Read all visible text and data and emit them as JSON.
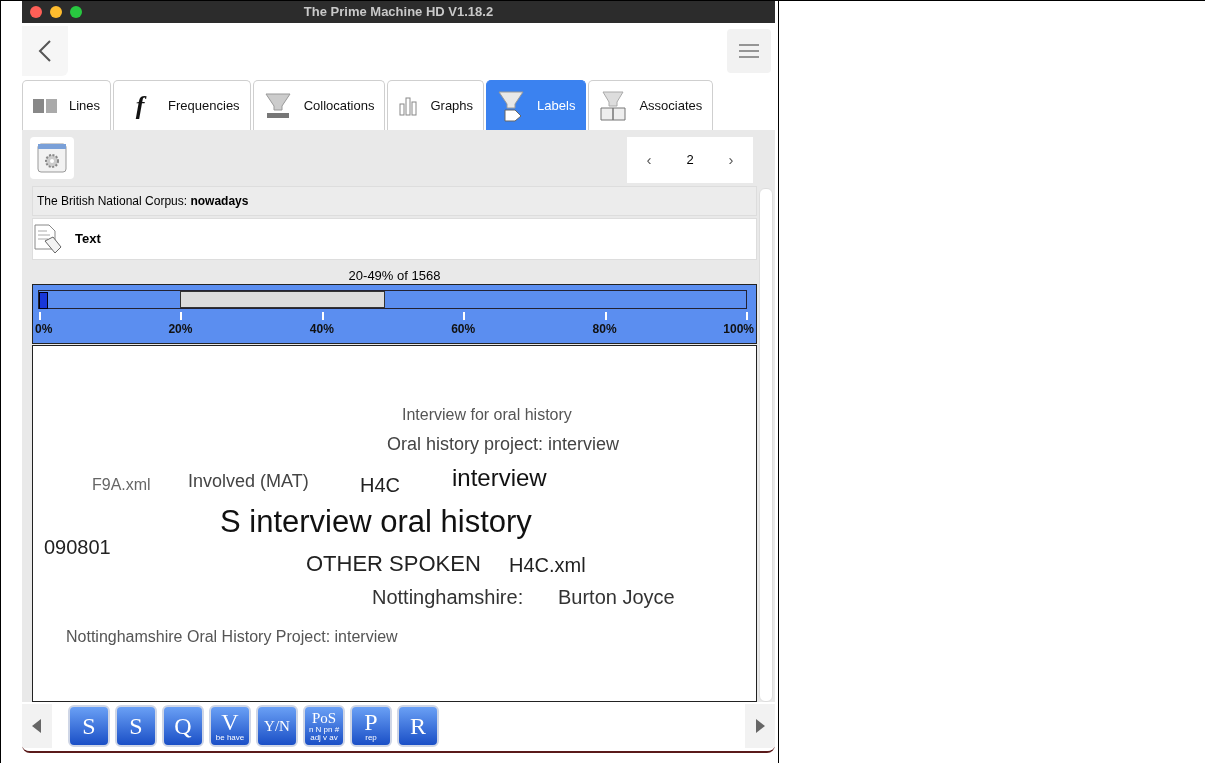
{
  "window": {
    "title": "The Prime Machine HD V1.18.2"
  },
  "tabs": [
    {
      "label": "Lines",
      "kind": "lines",
      "selected": false
    },
    {
      "label": "Frequencies",
      "kind": "glyph",
      "glyph": "f",
      "selected": false
    },
    {
      "label": "Collocations",
      "kind": "funnel",
      "selected": false
    },
    {
      "label": "Graphs",
      "kind": "graphs",
      "selected": false
    },
    {
      "label": "Labels",
      "kind": "labels",
      "selected": true
    },
    {
      "label": "Associates",
      "kind": "book",
      "selected": false
    }
  ],
  "pager": {
    "prev": "‹",
    "page": "2",
    "next": "›"
  },
  "corpus_line": "The British National Corpus: **nowadays**",
  "section": {
    "title": "Text"
  },
  "range": {
    "caption": "20-49% of 1568",
    "ticks": [
      "0%",
      "20%",
      "40%",
      "60%",
      "80%",
      "100%"
    ]
  },
  "cloud": [
    {
      "text": "Interview for oral history"
    },
    {
      "text": "Oral history project: interview"
    },
    {
      "text": "F9A.xml"
    },
    {
      "text": "Involved (MAT)"
    },
    {
      "text": "H4C"
    },
    {
      "text": "interview"
    },
    {
      "text": "S interview oral history"
    },
    {
      "text": "090801"
    },
    {
      "text": "OTHER SPOKEN"
    },
    {
      "text": "H4C.xml"
    },
    {
      "text": "Nottinghamshire:"
    },
    {
      "text": "Burton Joyce"
    },
    {
      "text": "Nottinghamshire Oral History Project: interview"
    }
  ],
  "tools": [
    {
      "letter": "S"
    },
    {
      "letter": "S"
    },
    {
      "letter": "Q"
    },
    {
      "letter": "V",
      "sub": "be have"
    },
    {
      "letter": "Y/N"
    },
    {
      "letter": "PoS",
      "sub": "n N pn # adj v av"
    },
    {
      "letter": "P",
      "sub": "rep"
    },
    {
      "letter": "R"
    }
  ]
}
